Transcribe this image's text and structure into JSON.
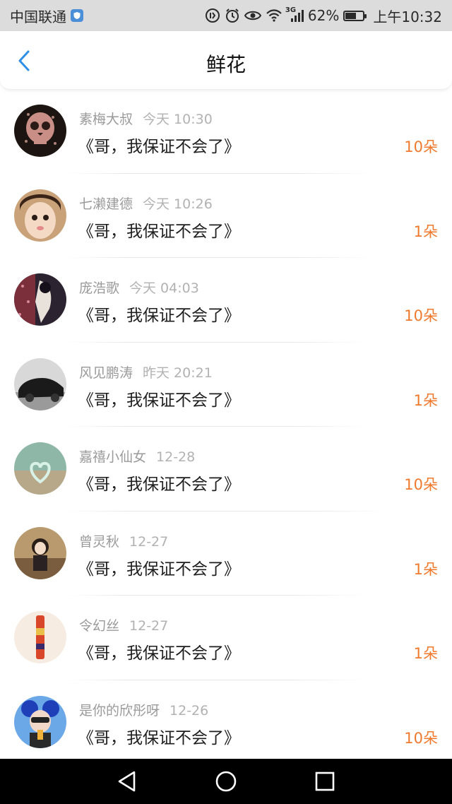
{
  "status_bar": {
    "carrier": "中国联通",
    "signal_type": "3G",
    "battery_percent": "62%",
    "battery_level": 0.62,
    "time": "上午10:32",
    "icons": [
      "shield-icon",
      "data-saver-icon",
      "alarm-icon",
      "eye-icon",
      "wifi-icon",
      "signal-icon",
      "battery-icon"
    ]
  },
  "header": {
    "title": "鲜花",
    "back_icon": "chevron-left-icon",
    "accent_color": "#2f8fe6"
  },
  "items": [
    {
      "name": "素梅大叔",
      "time": "今天 10:30",
      "message": "《哥，我保证不会了》",
      "count": "10朵"
    },
    {
      "name": "七濑建德",
      "time": "今天 10:26",
      "message": "《哥，我保证不会了》",
      "count": "1朵"
    },
    {
      "name": "庞浩歌",
      "time": "今天 04:03",
      "message": "《哥，我保证不会了》",
      "count": "10朵"
    },
    {
      "name": "风见鹏涛",
      "time": "昨天 20:21",
      "message": "《哥，我保证不会了》",
      "count": "1朵"
    },
    {
      "name": "嘉禧小仙女",
      "time": "12-28",
      "message": "《哥，我保证不会了》",
      "count": "10朵"
    },
    {
      "name": "曾灵秋",
      "time": "12-27",
      "message": "《哥，我保证不会了》",
      "count": "1朵"
    },
    {
      "name": "令幻丝",
      "time": "12-27",
      "message": "《哥，我保证不会了》",
      "count": "1朵"
    },
    {
      "name": "是你的欣彤呀",
      "time": "12-26",
      "message": "《哥，我保证不会了》",
      "count": "10朵"
    }
  ],
  "colors": {
    "count": "#ef7a2d",
    "name": "#9a9a9a",
    "message": "#1e1e1e"
  },
  "nav_bar": {
    "icons": [
      "back-triangle-icon",
      "home-circle-icon",
      "recents-square-icon"
    ]
  }
}
